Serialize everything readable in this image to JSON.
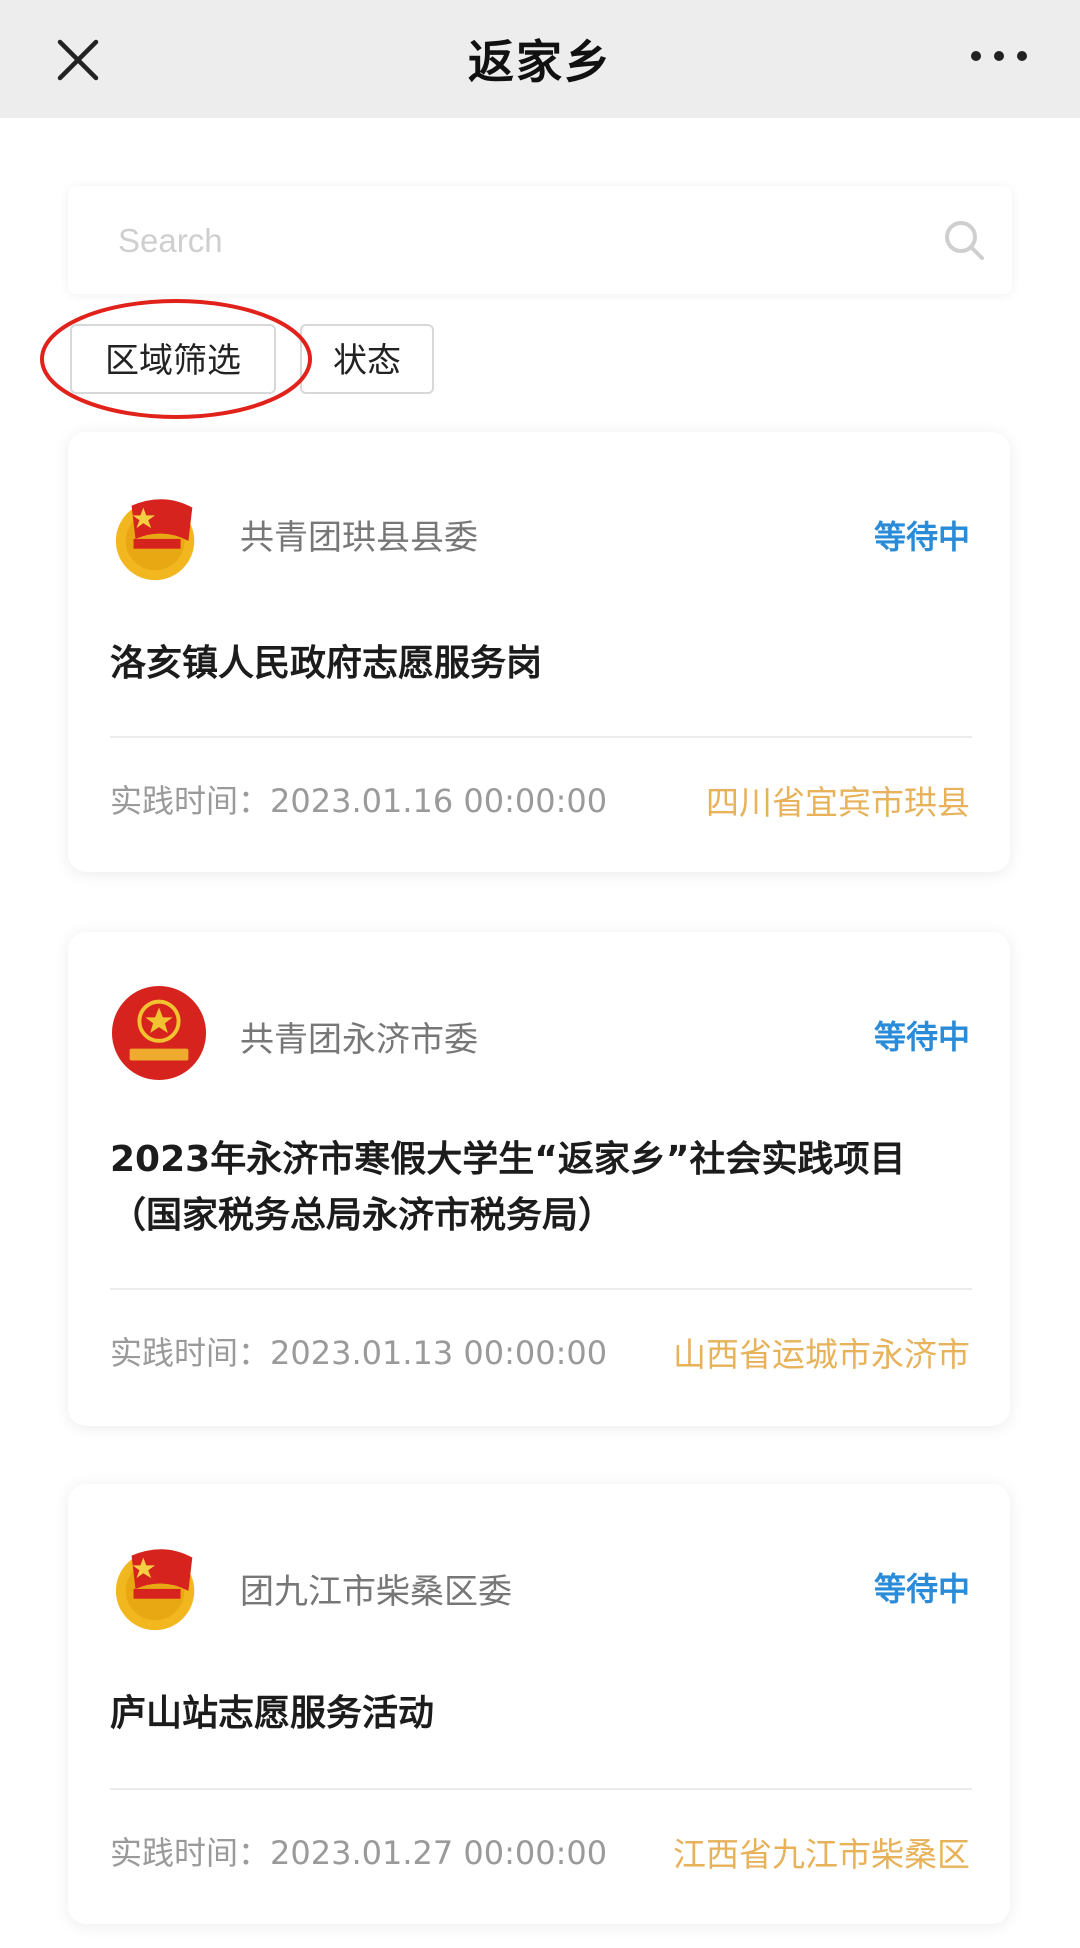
{
  "header": {
    "title": "返家乡",
    "close_icon": "close-icon",
    "more_icon": "more-dots-icon"
  },
  "search": {
    "placeholder": "Search",
    "value": ""
  },
  "filters": {
    "region_label": "区域筛选",
    "status_label": "状态"
  },
  "colors": {
    "status": "#2a8bd8",
    "location": "#e7b25a",
    "annotation": "#e0221b"
  },
  "cards": [
    {
      "org": "共青团珙县县委",
      "status": "等待中",
      "title": "洛亥镇人民政府志愿服务岗",
      "time": "实践时间：2023.01.16 00:00:00",
      "location": "四川省宜宾市珙县"
    },
    {
      "org": "共青团永济市委",
      "status": "等待中",
      "title": "2023年永济市寒假大学生“返家乡”社会实践项目（国家税务总局永济市税务局）",
      "time": "实践时间：2023.01.13 00:00:00",
      "location": "山西省运城市永济市"
    },
    {
      "org": "团九江市柴桑区委",
      "status": "等待中",
      "title": "庐山站志愿服务活动",
      "time": "实践时间：2023.01.27 00:00:00",
      "location": "江西省九江市柴桑区"
    }
  ]
}
